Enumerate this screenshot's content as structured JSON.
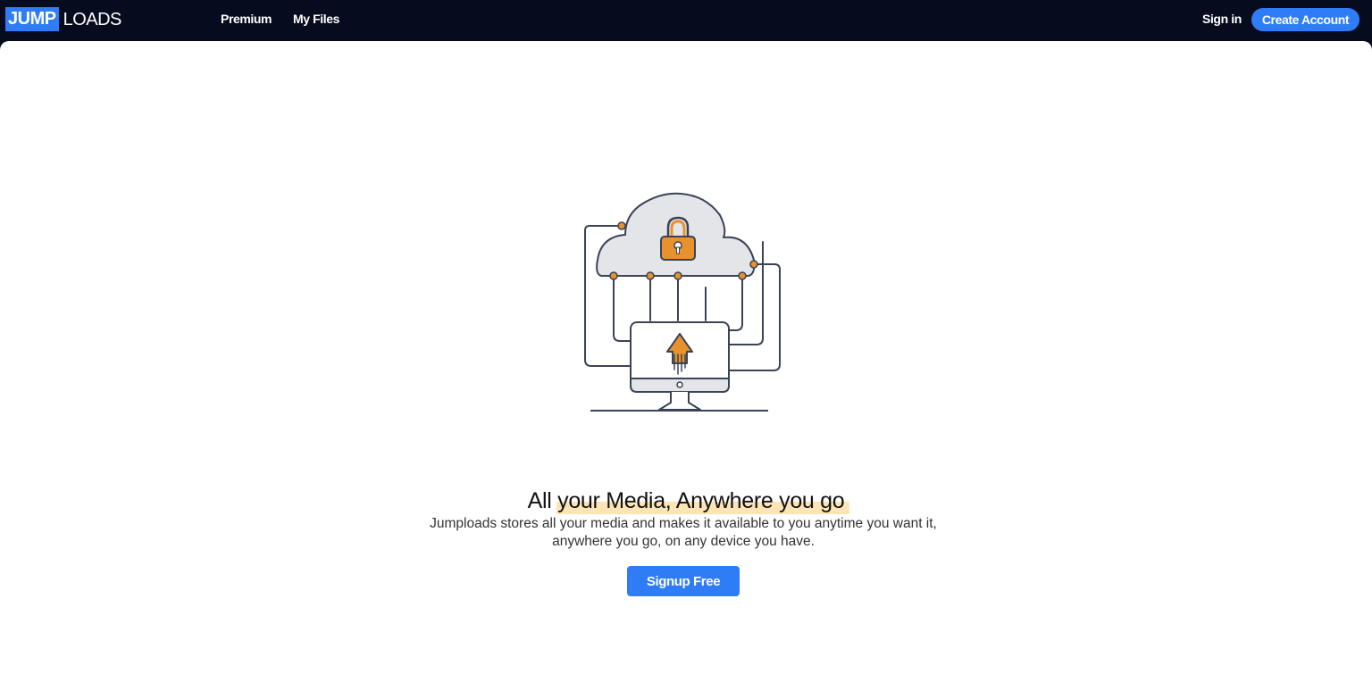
{
  "brand": {
    "logo_part1": "JUMP",
    "logo_part2": "LOADS"
  },
  "nav": {
    "links": [
      {
        "label": "Premium"
      },
      {
        "label": "My Files"
      }
    ],
    "sign_in": "Sign in",
    "create_account": "Create Account"
  },
  "hero": {
    "headline": "All your Media, Anywhere you go",
    "description": "Jumploads stores all your media and makes it available to you anytime you want it, anywhere you go, on any device you have.",
    "cta": "Signup Free",
    "illustration_icons": [
      "cloud-icon",
      "padlock-icon",
      "monitor-icon",
      "upload-arrow-icon"
    ]
  },
  "colors": {
    "nav_background": "#060b1e",
    "accent_blue": "#2f7df6",
    "accent_orange": "#e8922e",
    "highlight": "#fde4b4"
  }
}
